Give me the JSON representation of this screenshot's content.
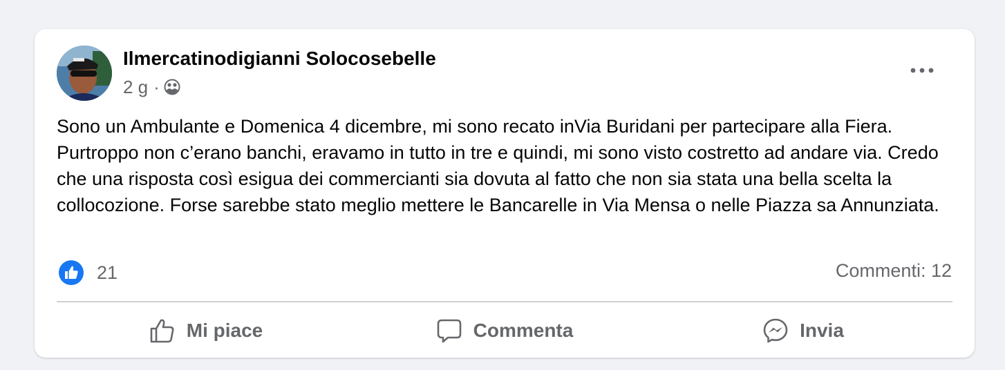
{
  "post": {
    "author": "Ilmercatinodigianni Solocosebelle",
    "time": "2 g",
    "separator": "·",
    "audience_icon": "friends-icon",
    "text": "Sono un Ambulante e Domenica 4 dicembre, mi sono recato inVia Buridani per partecipare alla Fiera. Purtroppo non c’erano banchi, eravamo in tutto in tre e quindi, mi sono visto costretto ad andare via. Credo che una risposta così esigua dei commercianti sia dovuta al fatto che non sia stata una bella scelta la collocozione. Forse sarebbe stato meglio mettere le Bancarelle in Via Mensa o nelle Piazza sa Annunziata.",
    "reactions": {
      "icon": "like-reaction-icon",
      "count": "21"
    },
    "comments_label": "Commenti: 12"
  },
  "actions": {
    "like": {
      "label": "Mi piace",
      "icon": "thumbs-up-icon"
    },
    "comment": {
      "label": "Commenta",
      "icon": "comment-bubble-icon"
    },
    "share": {
      "label": "Invia",
      "icon": "messenger-icon"
    }
  },
  "colors": {
    "background": "#f0f2f5",
    "card": "#ffffff",
    "text_primary": "#050505",
    "text_secondary": "#65676b",
    "like_blue": "#1877f2",
    "divider": "#ced0d4"
  }
}
